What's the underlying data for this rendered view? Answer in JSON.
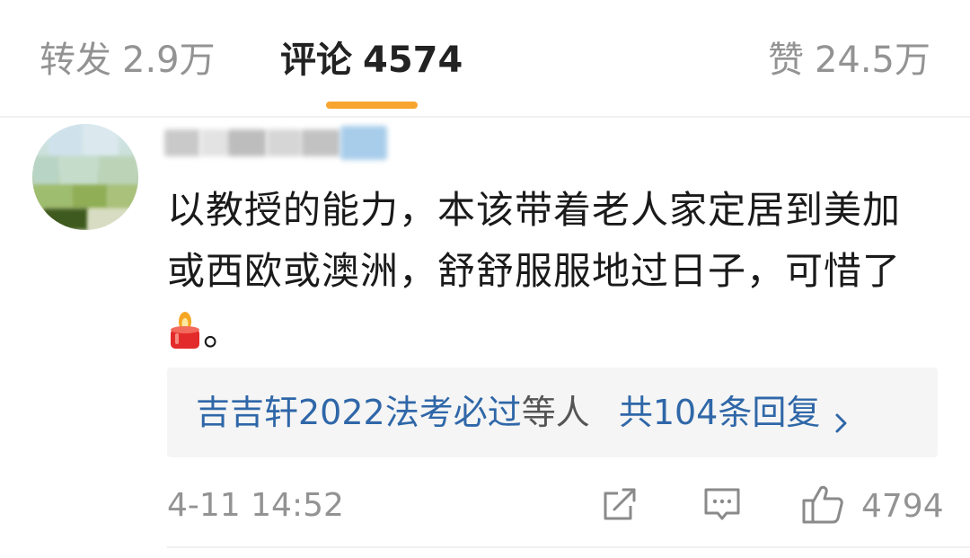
{
  "tabs": {
    "reposts": {
      "label": "转发",
      "count": "2.9万"
    },
    "comments": {
      "label": "评论",
      "count": "4574"
    },
    "likes": {
      "label": "赞",
      "count": "24.5万"
    }
  },
  "colors": {
    "active_indicator": "#f7a52e",
    "link_blue": "#2f67a8",
    "muted_text": "#939393"
  },
  "comment": {
    "text_lines": [
      "以教授的能力，本该带着老人家定居到美加",
      "或西欧或澳洲，舒舒服服地过日子，可惜了"
    ],
    "text_tail": "。",
    "emoji_icon": "candle-icon",
    "replies": {
      "names": "吉吉轩2022法考必过",
      "suffix": "等人",
      "total": "共104条回复"
    },
    "timestamp": "4-11 14:52",
    "like_count": "4794"
  },
  "icons": {
    "share": "share-icon",
    "comment": "comment-icon",
    "like": "thumbs-up-icon",
    "chevron": "chevron-right-icon"
  }
}
